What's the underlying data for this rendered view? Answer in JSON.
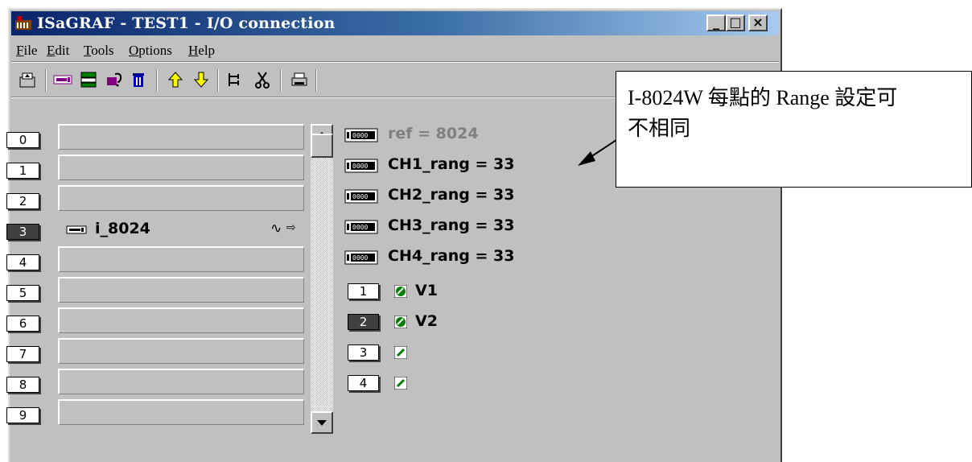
{
  "window": {
    "title": "ISaGRAF - TEST1 - I/O connection"
  },
  "caption_buttons": {
    "minimize": "_",
    "maximize": "□",
    "close": "×"
  },
  "menu": [
    {
      "label": "File",
      "accel": "F",
      "rest": "ile"
    },
    {
      "label": "Edit",
      "accel": "E",
      "rest": "dit"
    },
    {
      "label": "Tools",
      "accel": "T",
      "rest": "ools"
    },
    {
      "label": "Options",
      "accel": "O",
      "rest": "ptions"
    },
    {
      "label": "Help",
      "accel": "H",
      "rest": "elp"
    }
  ],
  "toolbar_icons": [
    "save-icon",
    "board-icon",
    "equipment-icon",
    "parameters-icon",
    "delete-icon",
    "move-up-icon",
    "move-down-icon",
    "structure-icon",
    "cut-icon",
    "print-icon"
  ],
  "slots": [
    {
      "num": "0",
      "board": ""
    },
    {
      "num": "1",
      "board": ""
    },
    {
      "num": "2",
      "board": ""
    },
    {
      "num": "3",
      "board": "i_8024",
      "selected": true
    },
    {
      "num": "4",
      "board": ""
    },
    {
      "num": "5",
      "board": ""
    },
    {
      "num": "6",
      "board": ""
    },
    {
      "num": "7",
      "board": ""
    },
    {
      "num": "8",
      "board": ""
    },
    {
      "num": "9",
      "board": ""
    }
  ],
  "parameters": [
    {
      "text": "ref = 8024",
      "dim": true
    },
    {
      "text": "CH1_rang = 33"
    },
    {
      "text": "CH2_rang = 33"
    },
    {
      "text": "CH3_rang = 33"
    },
    {
      "text": "CH4_rang = 33"
    }
  ],
  "channels": [
    {
      "num": "1",
      "label": "V1",
      "connected": true
    },
    {
      "num": "2",
      "label": "V2",
      "connected": true,
      "selected": true
    },
    {
      "num": "3",
      "label": "",
      "connected": false
    },
    {
      "num": "4",
      "label": "",
      "connected": false
    }
  ],
  "annotation": {
    "line1": "I-8024W 每點的 Range 設定可",
    "line2": "不相同"
  }
}
